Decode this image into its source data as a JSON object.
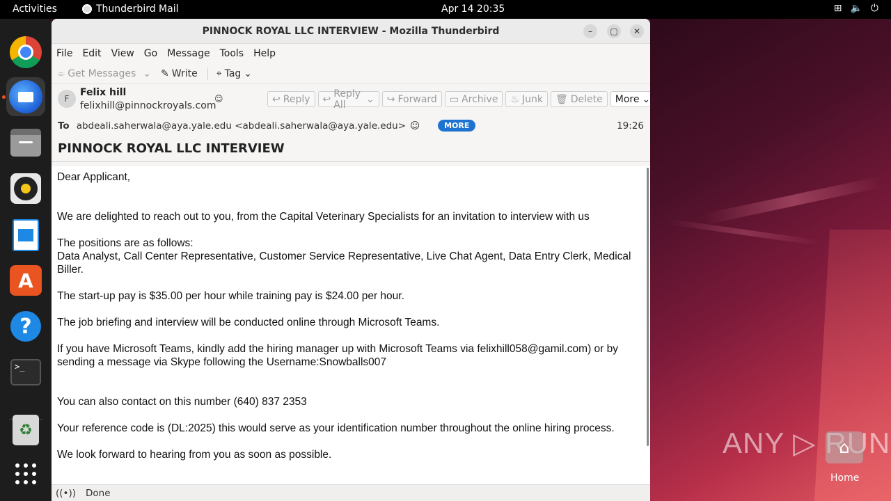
{
  "topbar": {
    "activities": "Activities",
    "app_name": "Thunderbird Mail",
    "clock": "Apr 14  20:35",
    "status_icons": [
      "network-icon",
      "volume-icon",
      "power-icon"
    ]
  },
  "dock": {
    "items": [
      "chrome-icon",
      "thunderbird-icon",
      "files-icon",
      "rhythmbox-icon",
      "writer-icon",
      "software-icon",
      "help-icon",
      "terminal-icon",
      "trash-icon",
      "app-grid-icon"
    ]
  },
  "window": {
    "title": "PINNOCK ROYAL LLC INTERVIEW - Mozilla Thunderbird",
    "menu": [
      "File",
      "Edit",
      "View",
      "Go",
      "Message",
      "Tools",
      "Help"
    ],
    "toolbar": {
      "get_messages": "Get Messages",
      "write": "Write",
      "tag": "Tag"
    },
    "header": {
      "avatar_initial": "F",
      "from_name": "Felix hill",
      "from_email": "felixhill@pinnockroyals.com",
      "actions": {
        "reply": "Reply",
        "reply_all": "Reply All",
        "forward": "Forward",
        "archive": "Archive",
        "junk": "Junk",
        "delete": "Delete",
        "more": "More"
      },
      "to_label": "To",
      "to_value": "abdeali.saherwala@aya.yale.edu <abdeali.saherwala@aya.yale.edu>",
      "more_badge": "MORE",
      "time": "19:26",
      "subject": "PINNOCK ROYAL LLC INTERVIEW"
    },
    "body": {
      "p1": "Dear Applicant,",
      "p2": "We are delighted to reach out to you, from the Capital Veterinary Specialists for an invitation to interview with us",
      "p3a": "The positions are as follows:",
      "p3b": "Data Analyst, Call Center Representative, Customer Service Representative, Live Chat Agent, Data Entry Clerk, Medical Biller.",
      "p4": "The start-up pay is $35.00 per hour while training pay is $24.00 per hour.",
      "p5": "The job briefing and interview will be conducted online through Microsoft Teams.",
      "p6": "If you have Microsoft Teams, kindly add the hiring manager up with Microsoft Teams via felixhill058@gamil.com) or by sending a message via Skype following the Username:Snowballs007",
      "p7": "You can also contact on this number (640) 837 2353",
      "p8": "Your reference code is (DL:2025) this would serve as your identification number throughout the online hiring process.",
      "p9": "We look forward to hearing from you as soon as possible."
    },
    "status": "Done"
  },
  "desktop": {
    "watermark": "ANY RUN",
    "home_label": "Home"
  }
}
